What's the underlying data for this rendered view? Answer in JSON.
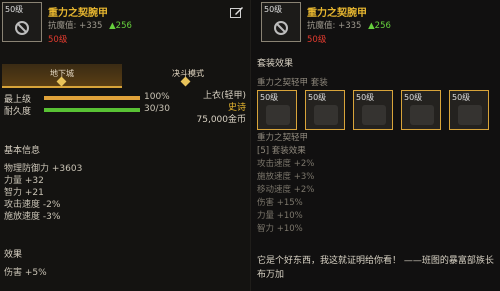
{
  "left": {
    "item": {
      "level": "50级",
      "name": "重力之契腕甲",
      "stat_label": "抗魔值:",
      "stat_value": "+335",
      "stat_up": "▲256",
      "requirement": "50级"
    },
    "tabs": [
      {
        "label": "地下城",
        "active": true
      },
      {
        "label": "决斗模式",
        "active": false
      }
    ],
    "grade": {
      "label": "最上级",
      "value": "100%",
      "fraction": 1.0
    },
    "durability": {
      "label": "耐久度",
      "value": "30/30",
      "fraction": 1.0
    },
    "equip": {
      "slot": "上衣(轻甲)",
      "rarity": "史诗",
      "price": "75,000金币"
    },
    "basic_title": "基本信息",
    "basic_stats": [
      "物理防御力 +3603",
      "力量 +32",
      "智力 +21",
      "攻击速度 -2%",
      "施放速度 -3%"
    ],
    "effect_title": "效果",
    "effects": [
      "伤害 +5%"
    ]
  },
  "right": {
    "item": {
      "level": "50级",
      "name": "重力之契腕甲",
      "stat_label": "抗魔值:",
      "stat_value": "+335",
      "stat_up": "▲256",
      "requirement": "50级"
    },
    "set_title": "套装效果",
    "set_name_header": "重力之契轻甲 套装",
    "slots": [
      "50级",
      "50级",
      "50级",
      "50级",
      "50级"
    ],
    "set_lines": [
      "重力之契轻甲",
      "[5] 套装效果",
      "攻击速度 +2%",
      "施放速度 +3%",
      "移动速度 +2%",
      "伤害 +15%",
      "力量 +10%",
      "智力 +10%"
    ],
    "flavor": "它是个好东西，我这就证明给你看！ ——班图的暴富部族长布万加"
  },
  "colors": {
    "gold": "#e8b730",
    "green": "#66d03d",
    "red": "#e23b2f",
    "bar_gold": "#e0a23a",
    "bar_green": "#59c234"
  }
}
